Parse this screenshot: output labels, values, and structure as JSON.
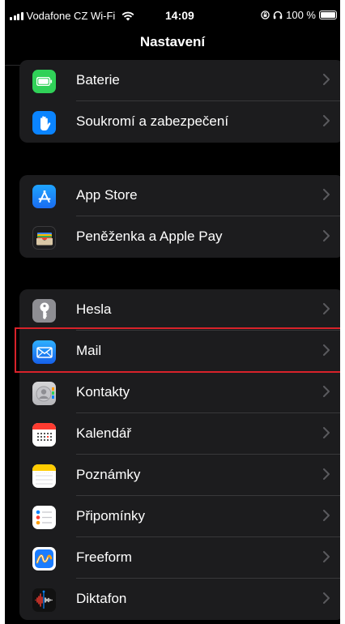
{
  "status": {
    "carrier": "Vodafone CZ Wi-Fi",
    "time": "14:09",
    "battery": "100 %"
  },
  "nav": {
    "title": "Nastavení"
  },
  "groups": [
    {
      "items": [
        {
          "label": "Baterie",
          "icon": "battery-icon",
          "color": "#30d158"
        },
        {
          "label": "Soukromí a zabezpečení",
          "icon": "hand-icon",
          "color": "#0a84ff"
        }
      ]
    },
    {
      "items": [
        {
          "label": "App Store",
          "icon": "app-store-icon",
          "color": "#1c8cff"
        },
        {
          "label": "Peněženka a Apple Pay",
          "icon": "wallet-icon",
          "color": "#2c2c2e"
        }
      ]
    },
    {
      "items": [
        {
          "label": "Hesla",
          "icon": "key-icon",
          "color": "#8e8e93"
        },
        {
          "label": "Mail",
          "icon": "mail-icon",
          "color": "#1a8cff"
        },
        {
          "label": "Kontakty",
          "icon": "contacts-icon",
          "color": "#c7c7cc"
        },
        {
          "label": "Kalendář",
          "icon": "calendar-icon",
          "color": "#ffffff"
        },
        {
          "label": "Poznámky",
          "icon": "notes-icon",
          "color": "#ffffff"
        },
        {
          "label": "Připomínky",
          "icon": "reminders-icon",
          "color": "#ffffff"
        },
        {
          "label": "Freeform",
          "icon": "freeform-icon",
          "color": "#ffffff"
        },
        {
          "label": "Diktafon",
          "icon": "voice-memos-icon",
          "color": "#1c1c1e"
        }
      ]
    }
  ],
  "colors": {
    "highlight": "#d8222a",
    "chevron": "#5a5a5e"
  }
}
